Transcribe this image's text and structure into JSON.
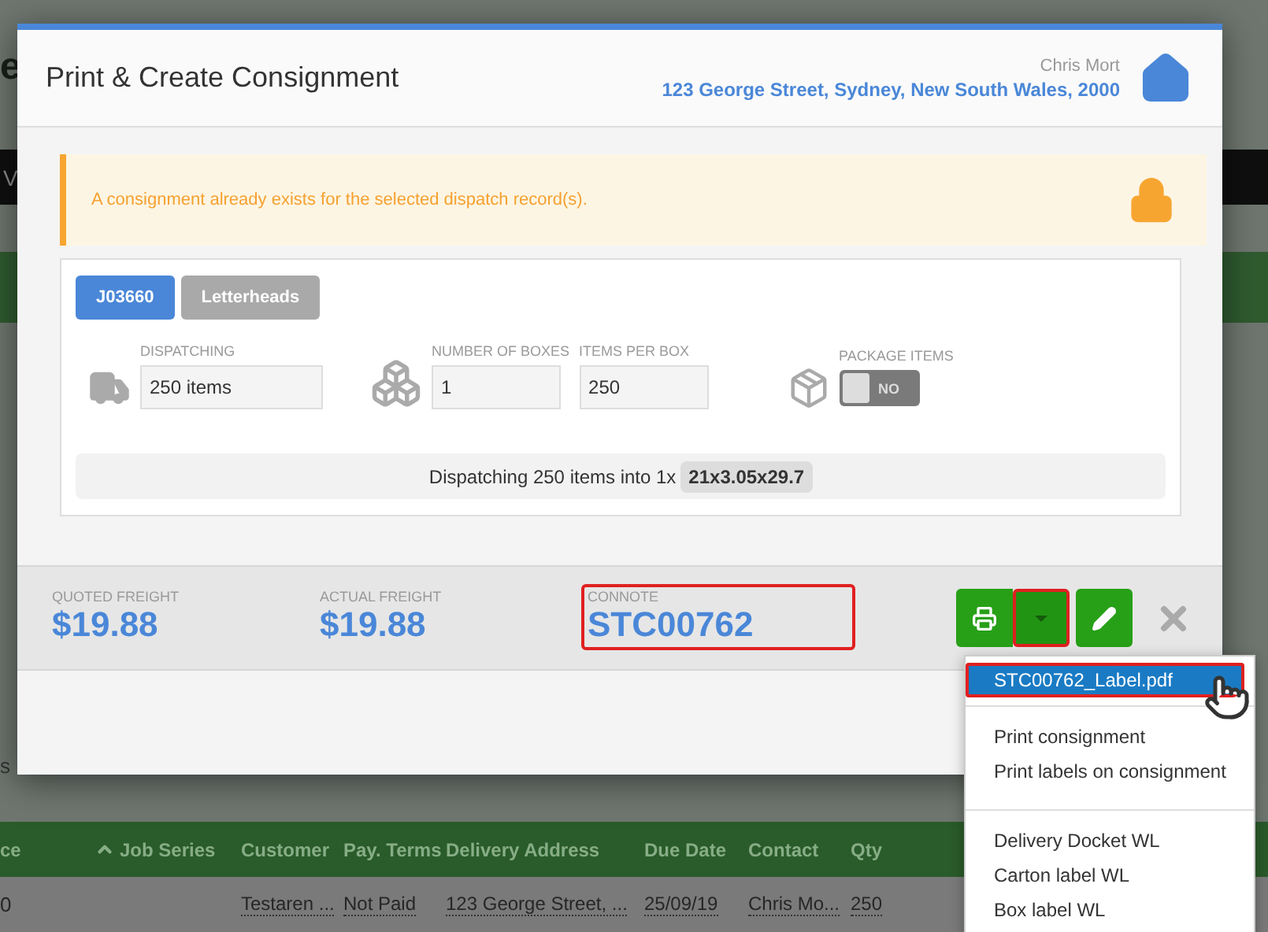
{
  "background": {
    "brand_fragment": "e",
    "nav_fragment": "V",
    "filter_fragment": "s",
    "table": {
      "columns": [
        {
          "label": "ce",
          "sorted": false
        },
        {
          "label": "Job Series",
          "sorted": true
        },
        {
          "label": "Customer",
          "sorted": false
        },
        {
          "label": "Pay. Terms",
          "sorted": false
        },
        {
          "label": "Delivery Address",
          "sorted": false
        },
        {
          "label": "Due Date",
          "sorted": false
        },
        {
          "label": "Contact",
          "sorted": false
        },
        {
          "label": "Qty",
          "sorted": false
        }
      ],
      "row": [
        "0",
        "Testaren ...",
        "Not Paid",
        "123 George Street, ...",
        "25/09/19",
        "Chris Mo...",
        "250"
      ]
    }
  },
  "modal": {
    "title": "Print & Create Consignment",
    "user": "Chris Mort",
    "address": "123 George Street, Sydney, New South Wales, 2000",
    "alert": {
      "text": "A consignment already exists for the selected dispatch record(s).",
      "locked": true
    },
    "tabs": [
      {
        "label": "J03660",
        "selected": true
      },
      {
        "label": "Letterheads",
        "selected": false
      }
    ],
    "groups": [
      {
        "fields": [
          {
            "kind": "input",
            "label": "DISPATCHING",
            "value": "250 items"
          }
        ]
      },
      {
        "fields": [
          {
            "kind": "input",
            "label": "NUMBER OF BOXES",
            "value": "1"
          },
          {
            "kind": "input",
            "label": "ITEMS PER BOX",
            "value": "250"
          }
        ]
      },
      {
        "fields": [
          {
            "kind": "toggle",
            "label": "PACKAGE ITEMS",
            "on": false,
            "text": "NO"
          }
        ]
      }
    ],
    "summary": {
      "text": "Dispatching 250 items into 1x",
      "size": "21x3.05x29.7"
    },
    "freight": [
      {
        "label": "QUOTED FREIGHT",
        "value": "$19.88",
        "highlighted": false
      },
      {
        "label": "ACTUAL FREIGHT",
        "value": "$19.88",
        "highlighted": false
      },
      {
        "label": "CONNOTE",
        "value": "STC00762",
        "highlighted": true
      }
    ],
    "caret_highlighted": true
  },
  "menu": {
    "groups": [
      [
        {
          "label": "STC00762_Label.pdf",
          "selected": true,
          "highlighted": true
        }
      ],
      [
        {
          "label": "Print consignment",
          "selected": false,
          "highlighted": false
        },
        {
          "label": "Print labels on consignment",
          "selected": false,
          "highlighted": false
        }
      ],
      [
        {
          "label": "Delivery Docket WL",
          "selected": false,
          "highlighted": false
        },
        {
          "label": "Carton label WL",
          "selected": false,
          "highlighted": false
        },
        {
          "label": "Box label WL",
          "selected": false,
          "highlighted": false
        }
      ]
    ]
  }
}
